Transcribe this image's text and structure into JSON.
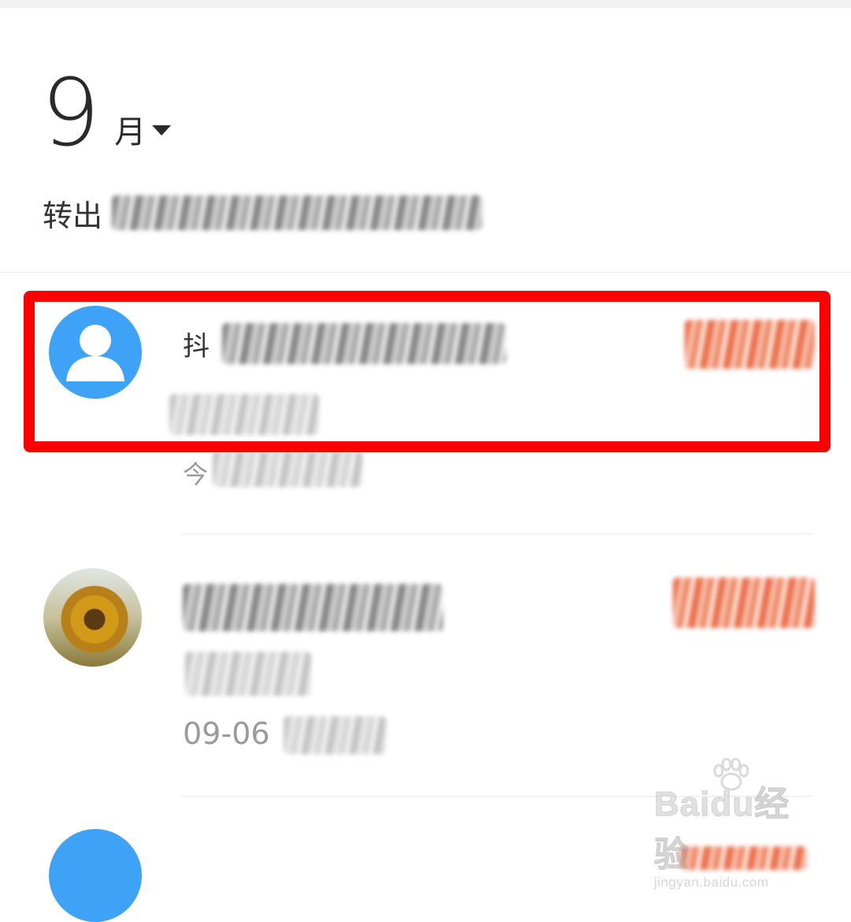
{
  "header": {
    "month_number": "9",
    "month_unit": "月",
    "dropdown_icon": "caret-down-icon"
  },
  "summary": {
    "label": "转出"
  },
  "transactions": [
    {
      "title_visible": "抖",
      "subtitle_visible": "",
      "time_visible": "今",
      "avatar_icon": "person-avatar-icon",
      "avatar_color": "#3ea3f7",
      "highlighted": true
    },
    {
      "title_visible": "",
      "subtitle_visible": "",
      "time_visible": "09-06",
      "avatar_icon": "sunflower-avatar-photo",
      "highlighted": false
    },
    {
      "avatar_icon": "person-avatar-icon",
      "avatar_color": "#3ea3f7",
      "highlighted": false
    }
  ],
  "colors": {
    "highlight_border": "#ff0000",
    "amount_color": "#e8552a",
    "avatar_blue": "#3ea3f7"
  },
  "watermark": {
    "brand": "Baidu经验",
    "url": "jingyan.baidu.com"
  }
}
